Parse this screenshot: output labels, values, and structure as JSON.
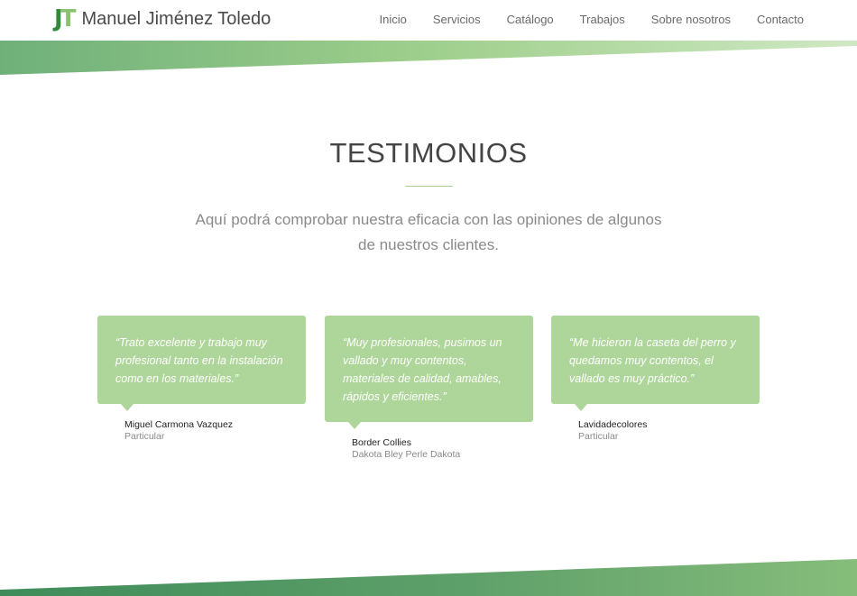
{
  "header": {
    "logo_j": "J",
    "logo_t": "T",
    "brand": "Manuel Jiménez Toledo",
    "nav": [
      "Inicio",
      "Servicios",
      "Catálogo",
      "Trabajos",
      "Sobre nosotros",
      "Contacto"
    ]
  },
  "colors": {
    "accent_green": "#afd69a",
    "dark_green": "#2f8a3a",
    "band_start": "#84bf75",
    "band_end": "#5fa06a"
  },
  "section": {
    "title": "TESTIMONIOS",
    "subtitle": "Aquí podrá comprobar nuestra eficacia con las opiniones de algunos de nuestros clientes."
  },
  "testimonials": [
    {
      "quote": "“Trato excelente y trabajo muy profesional tanto en la instalación como en los materiales.”",
      "name": "Miguel Carmona Vazquez",
      "role": "Particular"
    },
    {
      "quote": "“Muy profesionales, pusimos un vallado y muy contentos, materiales de calidad, amables, rápidos y eficientes.”",
      "name": "Border Collies",
      "role": "Dakota Bley Perle Dakota"
    },
    {
      "quote": "“Me hicieron la caseta del perro y quedamos muy contentos, el vallado es muy práctico.”",
      "name": "Lavidadecolores",
      "role": "Particular"
    }
  ]
}
